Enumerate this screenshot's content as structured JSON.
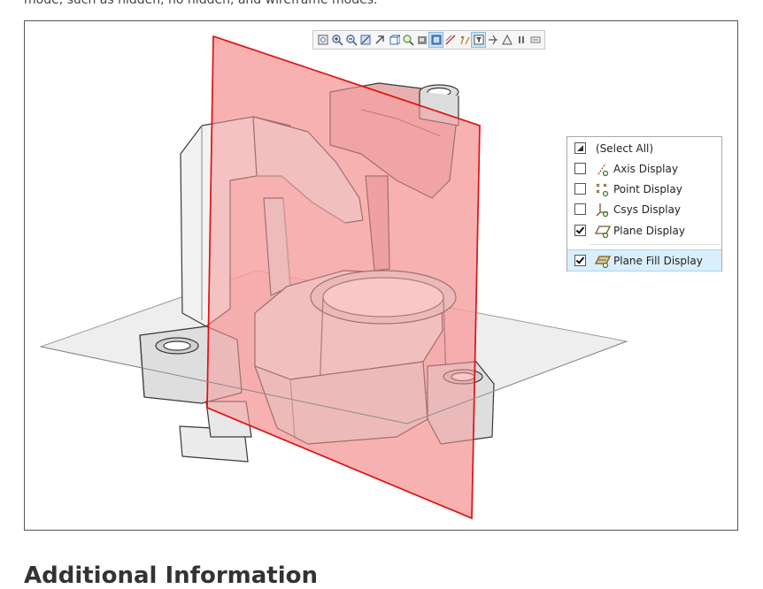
{
  "intro_text": "mode, such as hidden, no hidden, and wireframe modes.",
  "heading": "Additional Information",
  "toolbar": {
    "buttons": [
      {
        "icon": "zoom-box-icon"
      },
      {
        "icon": "zoom-in-icon"
      },
      {
        "icon": "zoom-out-icon"
      },
      {
        "icon": "fit-view-icon"
      },
      {
        "icon": "rotate-icon"
      },
      {
        "icon": "view-cube-icon"
      },
      {
        "icon": "zoom-window-icon"
      },
      {
        "icon": "shading-icon"
      },
      {
        "icon": "display-style-icon",
        "active": true
      },
      {
        "icon": "section-icon"
      },
      {
        "icon": "datum-display-icon"
      },
      {
        "icon": "filter-icon",
        "active": true
      },
      {
        "icon": "spin-center-icon"
      },
      {
        "icon": "annotation-icon"
      },
      {
        "icon": "pause-icon"
      },
      {
        "icon": "last-view-icon"
      }
    ]
  },
  "display_filter": {
    "items": [
      {
        "label": "(Select All)",
        "state": "indeterminate",
        "icon": ""
      },
      {
        "label": "Axis Display",
        "state": "unchecked",
        "icon": "axis-display-icon"
      },
      {
        "label": "Point Display",
        "state": "unchecked",
        "icon": "point-display-icon"
      },
      {
        "label": "Csys Display",
        "state": "unchecked",
        "icon": "csys-display-icon"
      },
      {
        "label": "Plane Display",
        "state": "checked",
        "icon": "plane-display-icon"
      },
      {
        "label": "Plane Fill Display",
        "state": "checked",
        "icon": "plane-fill-display-icon",
        "selected": true
      }
    ]
  },
  "colors": {
    "plane_fill": "#f79b9b",
    "plane_edge": "#e11010",
    "horizontal_plane": "#e9e9e9",
    "panel_selected": "#dbeefb"
  }
}
